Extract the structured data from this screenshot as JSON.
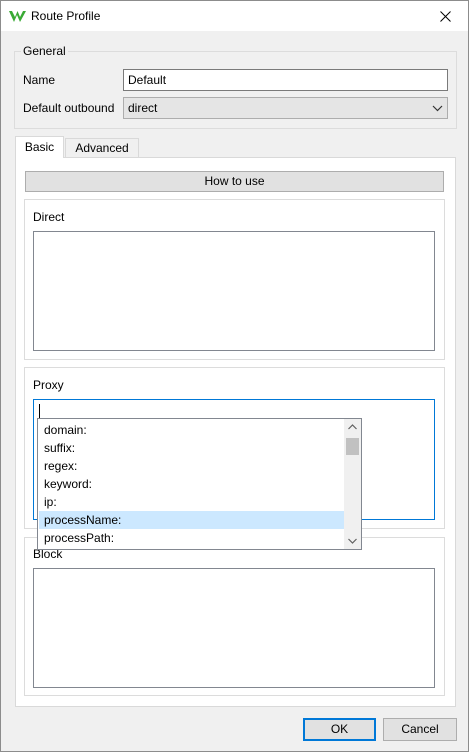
{
  "window": {
    "title": "Route Profile",
    "app_icon": "green-wing-logo-icon",
    "close_icon": "close-icon"
  },
  "general": {
    "legend": "General",
    "name_label": "Name",
    "name_value": "Default",
    "outbound_label": "Default outbound",
    "outbound_value": "direct"
  },
  "tabs": [
    {
      "label": "Basic",
      "active": true
    },
    {
      "label": "Advanced",
      "active": false
    }
  ],
  "basic": {
    "how_to_use": "How to use",
    "direct_label": "Direct",
    "proxy_label": "Proxy",
    "block_label": "Block"
  },
  "autocomplete": {
    "items": [
      "domain:",
      "suffix:",
      "regex:",
      "keyword:",
      "ip:",
      "processName:",
      "processPath:"
    ],
    "selected": "processName:"
  },
  "buttons": {
    "ok": "OK",
    "cancel": "Cancel"
  },
  "colors": {
    "accent": "#0078d7",
    "selection": "#cce8ff",
    "logo": "#3aaa35"
  }
}
